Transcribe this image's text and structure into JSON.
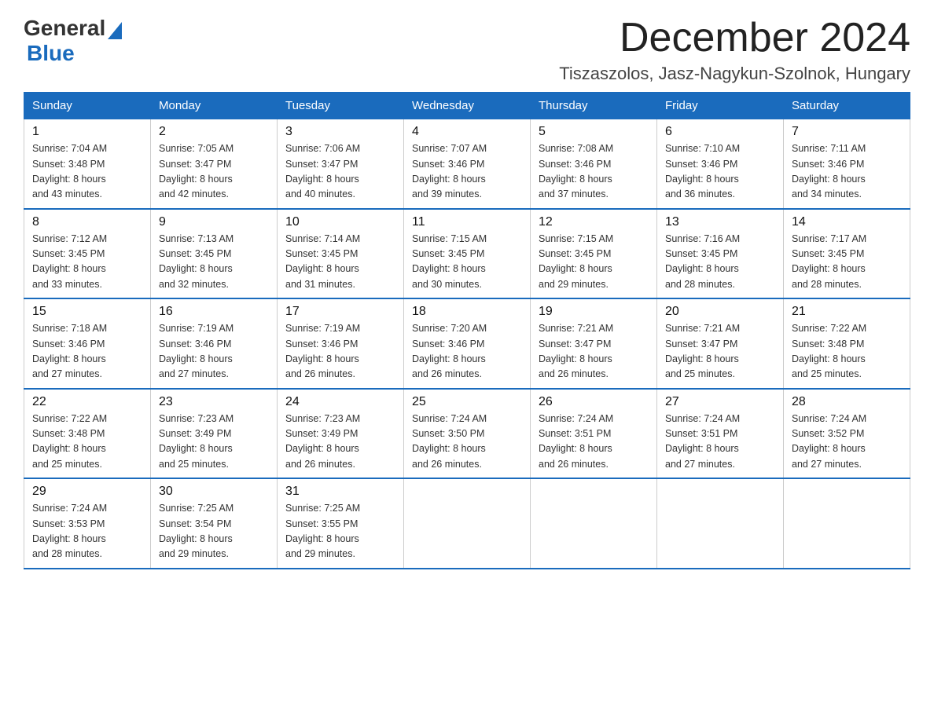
{
  "header": {
    "logo": {
      "general": "General",
      "blue": "Blue"
    },
    "title": "December 2024",
    "location": "Tiszaszolos, Jasz-Nagykun-Szolnok, Hungary"
  },
  "days_of_week": [
    "Sunday",
    "Monday",
    "Tuesday",
    "Wednesday",
    "Thursday",
    "Friday",
    "Saturday"
  ],
  "weeks": [
    [
      {
        "day": "1",
        "sunrise": "7:04 AM",
        "sunset": "3:48 PM",
        "daylight": "8 hours and 43 minutes."
      },
      {
        "day": "2",
        "sunrise": "7:05 AM",
        "sunset": "3:47 PM",
        "daylight": "8 hours and 42 minutes."
      },
      {
        "day": "3",
        "sunrise": "7:06 AM",
        "sunset": "3:47 PM",
        "daylight": "8 hours and 40 minutes."
      },
      {
        "day": "4",
        "sunrise": "7:07 AM",
        "sunset": "3:46 PM",
        "daylight": "8 hours and 39 minutes."
      },
      {
        "day": "5",
        "sunrise": "7:08 AM",
        "sunset": "3:46 PM",
        "daylight": "8 hours and 37 minutes."
      },
      {
        "day": "6",
        "sunrise": "7:10 AM",
        "sunset": "3:46 PM",
        "daylight": "8 hours and 36 minutes."
      },
      {
        "day": "7",
        "sunrise": "7:11 AM",
        "sunset": "3:46 PM",
        "daylight": "8 hours and 34 minutes."
      }
    ],
    [
      {
        "day": "8",
        "sunrise": "7:12 AM",
        "sunset": "3:45 PM",
        "daylight": "8 hours and 33 minutes."
      },
      {
        "day": "9",
        "sunrise": "7:13 AM",
        "sunset": "3:45 PM",
        "daylight": "8 hours and 32 minutes."
      },
      {
        "day": "10",
        "sunrise": "7:14 AM",
        "sunset": "3:45 PM",
        "daylight": "8 hours and 31 minutes."
      },
      {
        "day": "11",
        "sunrise": "7:15 AM",
        "sunset": "3:45 PM",
        "daylight": "8 hours and 30 minutes."
      },
      {
        "day": "12",
        "sunrise": "7:15 AM",
        "sunset": "3:45 PM",
        "daylight": "8 hours and 29 minutes."
      },
      {
        "day": "13",
        "sunrise": "7:16 AM",
        "sunset": "3:45 PM",
        "daylight": "8 hours and 28 minutes."
      },
      {
        "day": "14",
        "sunrise": "7:17 AM",
        "sunset": "3:45 PM",
        "daylight": "8 hours and 28 minutes."
      }
    ],
    [
      {
        "day": "15",
        "sunrise": "7:18 AM",
        "sunset": "3:46 PM",
        "daylight": "8 hours and 27 minutes."
      },
      {
        "day": "16",
        "sunrise": "7:19 AM",
        "sunset": "3:46 PM",
        "daylight": "8 hours and 27 minutes."
      },
      {
        "day": "17",
        "sunrise": "7:19 AM",
        "sunset": "3:46 PM",
        "daylight": "8 hours and 26 minutes."
      },
      {
        "day": "18",
        "sunrise": "7:20 AM",
        "sunset": "3:46 PM",
        "daylight": "8 hours and 26 minutes."
      },
      {
        "day": "19",
        "sunrise": "7:21 AM",
        "sunset": "3:47 PM",
        "daylight": "8 hours and 26 minutes."
      },
      {
        "day": "20",
        "sunrise": "7:21 AM",
        "sunset": "3:47 PM",
        "daylight": "8 hours and 25 minutes."
      },
      {
        "day": "21",
        "sunrise": "7:22 AM",
        "sunset": "3:48 PM",
        "daylight": "8 hours and 25 minutes."
      }
    ],
    [
      {
        "day": "22",
        "sunrise": "7:22 AM",
        "sunset": "3:48 PM",
        "daylight": "8 hours and 25 minutes."
      },
      {
        "day": "23",
        "sunrise": "7:23 AM",
        "sunset": "3:49 PM",
        "daylight": "8 hours and 25 minutes."
      },
      {
        "day": "24",
        "sunrise": "7:23 AM",
        "sunset": "3:49 PM",
        "daylight": "8 hours and 26 minutes."
      },
      {
        "day": "25",
        "sunrise": "7:24 AM",
        "sunset": "3:50 PM",
        "daylight": "8 hours and 26 minutes."
      },
      {
        "day": "26",
        "sunrise": "7:24 AM",
        "sunset": "3:51 PM",
        "daylight": "8 hours and 26 minutes."
      },
      {
        "day": "27",
        "sunrise": "7:24 AM",
        "sunset": "3:51 PM",
        "daylight": "8 hours and 27 minutes."
      },
      {
        "day": "28",
        "sunrise": "7:24 AM",
        "sunset": "3:52 PM",
        "daylight": "8 hours and 27 minutes."
      }
    ],
    [
      {
        "day": "29",
        "sunrise": "7:24 AM",
        "sunset": "3:53 PM",
        "daylight": "8 hours and 28 minutes."
      },
      {
        "day": "30",
        "sunrise": "7:25 AM",
        "sunset": "3:54 PM",
        "daylight": "8 hours and 29 minutes."
      },
      {
        "day": "31",
        "sunrise": "7:25 AM",
        "sunset": "3:55 PM",
        "daylight": "8 hours and 29 minutes."
      },
      null,
      null,
      null,
      null
    ]
  ],
  "labels": {
    "sunrise": "Sunrise:",
    "sunset": "Sunset:",
    "daylight": "Daylight:"
  }
}
